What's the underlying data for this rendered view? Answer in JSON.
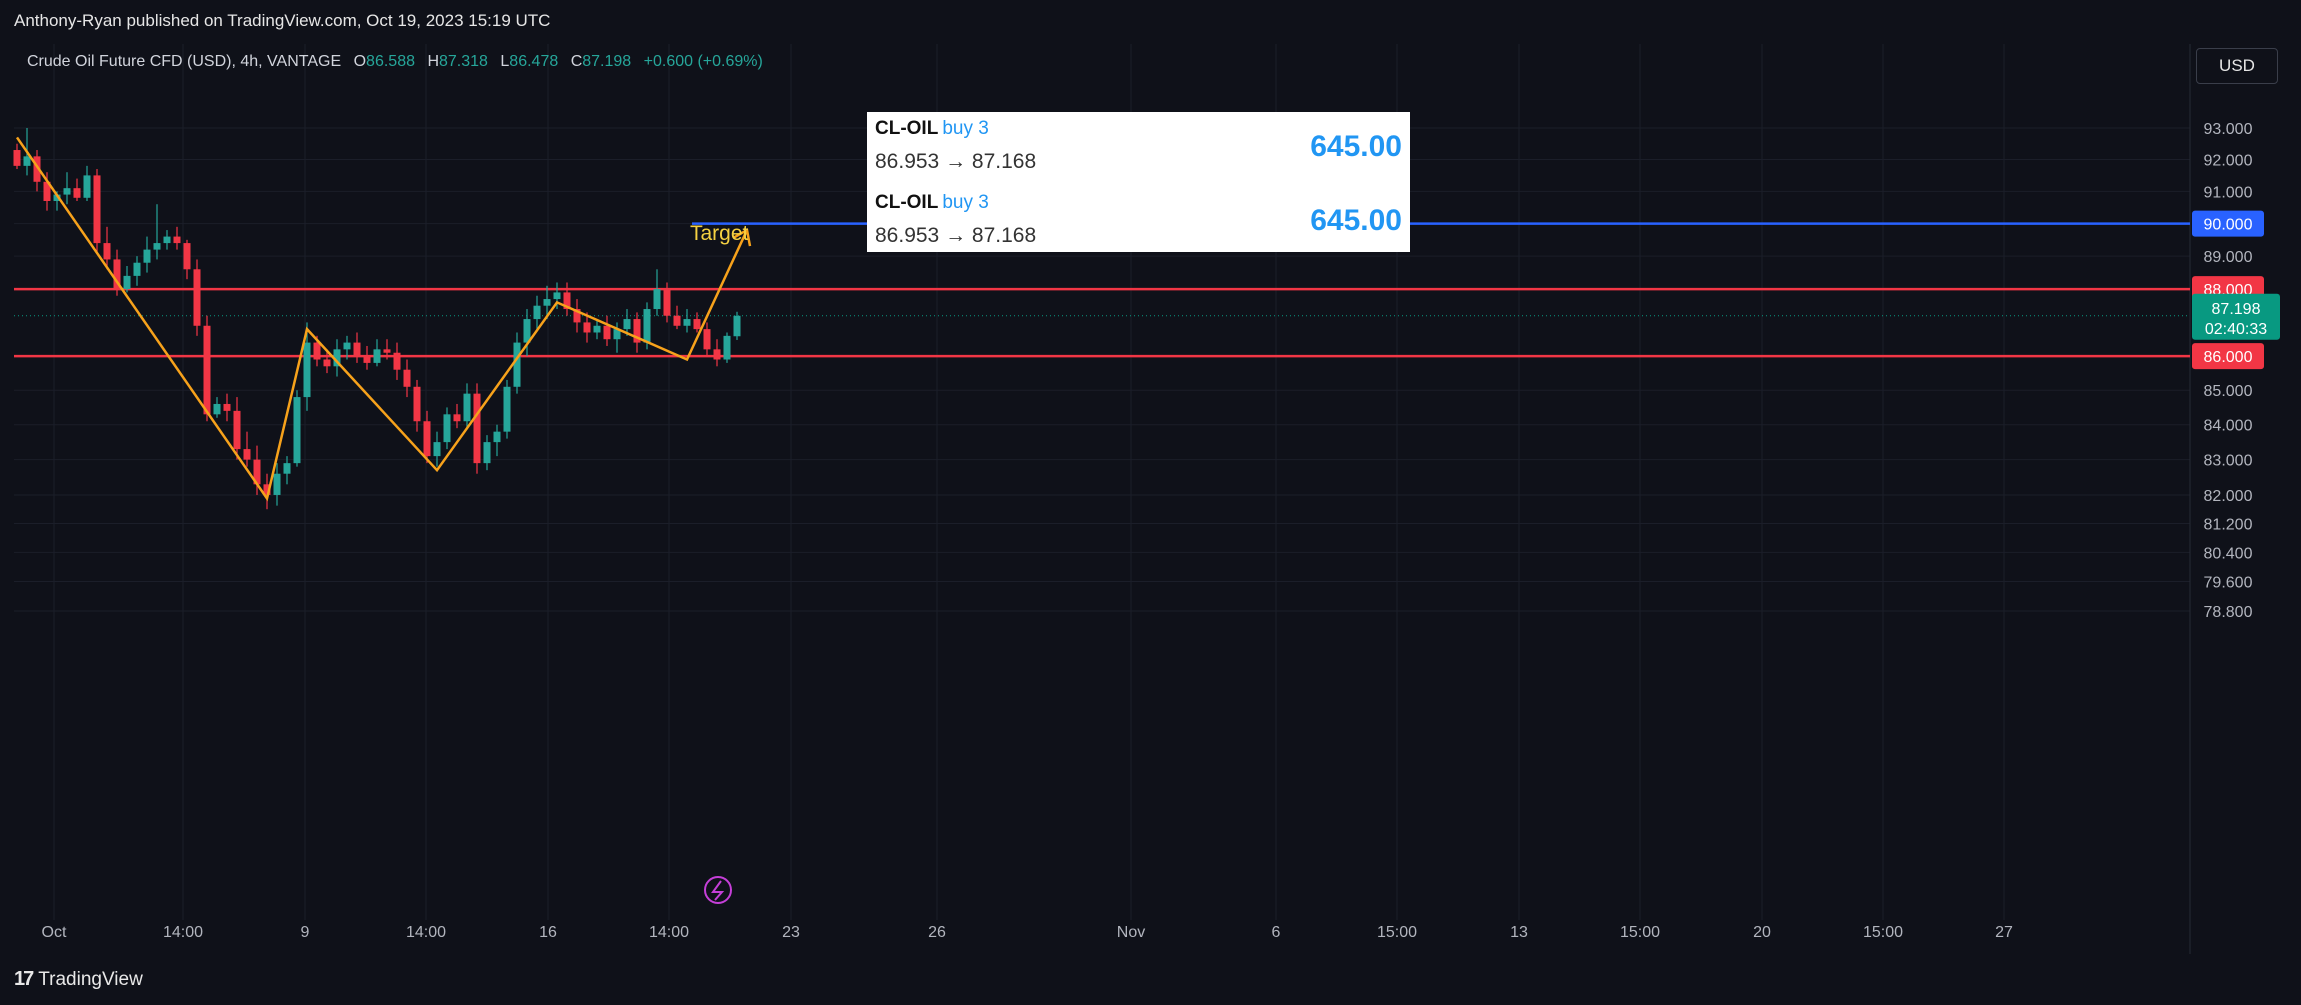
{
  "header": {
    "text": "Anthony-Ryan published on TradingView.com, Oct 19, 2023 15:19 UTC"
  },
  "legend": {
    "title": "Crude Oil Future CFD (USD), 4h, VANTAGE",
    "o_label": "O",
    "o_value": "86.588",
    "h_label": "H",
    "h_value": "87.318",
    "l_label": "L",
    "l_value": "86.478",
    "c_label": "C",
    "c_value": "87.198",
    "change": "+0.600 (+0.69%)"
  },
  "currency_button": "USD",
  "trade_box": {
    "rows": [
      {
        "symbol": "CL-OIL",
        "side": "buy 3",
        "prices": "86.953 → 87.168",
        "pnl": "645.00"
      },
      {
        "symbol": "CL-OIL",
        "side": "buy 3",
        "prices": "86.953 → 87.168",
        "pnl": "645.00"
      }
    ]
  },
  "footer": {
    "brand": "TradingView",
    "mark": "17"
  },
  "colors": {
    "background": "#0f1119",
    "up": "#26a69a",
    "down": "#f23645",
    "pattern": "#f7a21b",
    "target_line": "#2962ff",
    "support_resistance": "#f23645",
    "target_text": "#f5d142",
    "price_tag": "#089981"
  },
  "chart_data": {
    "type": "candlestick",
    "title": "Crude Oil Future CFD (USD), 4h, VANTAGE",
    "y_ticks": [
      "93.000",
      "92.000",
      "91.000",
      "90.000",
      "89.000",
      "88.000",
      "87.198",
      "86.000",
      "85.000",
      "84.000",
      "83.000",
      "82.000",
      "81.200",
      "80.400",
      "79.600",
      "78.800"
    ],
    "y_scale": "log",
    "x_ticks": [
      "Oct",
      "14:00",
      "9",
      "14:00",
      "16",
      "14:00",
      "23",
      "26",
      "Nov",
      "6",
      "15:00",
      "13",
      "15:00",
      "20",
      "15:00",
      "27"
    ],
    "horizontal_lines": [
      {
        "price": 90.0,
        "label": "90.000",
        "color": "#2962ff"
      },
      {
        "price": 88.0,
        "label": "88.000",
        "color": "#f23645"
      },
      {
        "price": 86.0,
        "label": "86.000",
        "color": "#f23645"
      }
    ],
    "last_price": {
      "value": 87.198,
      "label": "87.198",
      "countdown": "02:40:33"
    },
    "annotation": {
      "text": "Target"
    },
    "pattern_points": [
      [
        0,
        92.7
      ],
      [
        25,
        81.9
      ],
      [
        29,
        86.8
      ],
      [
        42,
        82.7
      ],
      [
        54,
        87.6
      ],
      [
        67,
        85.9
      ],
      [
        73,
        89.8
      ]
    ],
    "candles": [
      [
        92.3,
        92.5,
        91.7,
        91.8
      ],
      [
        91.8,
        93.0,
        91.5,
        92.1
      ],
      [
        92.1,
        92.3,
        91.0,
        91.3
      ],
      [
        91.3,
        91.6,
        90.4,
        90.7
      ],
      [
        90.7,
        91.0,
        90.4,
        90.9
      ],
      [
        90.9,
        91.6,
        90.6,
        91.1
      ],
      [
        91.1,
        91.4,
        90.7,
        90.8
      ],
      [
        90.8,
        91.8,
        90.7,
        91.5
      ],
      [
        91.5,
        91.7,
        89.1,
        89.4
      ],
      [
        89.4,
        89.9,
        88.6,
        88.9
      ],
      [
        88.9,
        89.2,
        87.8,
        88.0
      ],
      [
        88.0,
        88.7,
        87.9,
        88.4
      ],
      [
        88.4,
        89.0,
        88.1,
        88.8
      ],
      [
        88.8,
        89.6,
        88.5,
        89.2
      ],
      [
        89.2,
        90.6,
        88.9,
        89.4
      ],
      [
        89.4,
        89.8,
        89.2,
        89.6
      ],
      [
        89.6,
        89.9,
        89.2,
        89.4
      ],
      [
        89.4,
        89.5,
        88.3,
        88.6
      ],
      [
        88.6,
        88.9,
        86.6,
        86.9
      ],
      [
        86.9,
        87.2,
        84.1,
        84.3
      ],
      [
        84.3,
        84.8,
        84.2,
        84.6
      ],
      [
        84.6,
        84.9,
        84.1,
        84.4
      ],
      [
        84.4,
        84.8,
        83.0,
        83.3
      ],
      [
        83.3,
        83.8,
        82.8,
        83.0
      ],
      [
        83.0,
        83.4,
        82.0,
        82.3
      ],
      [
        82.3,
        82.6,
        81.6,
        82.0
      ],
      [
        82.0,
        82.9,
        81.7,
        82.6
      ],
      [
        82.6,
        83.1,
        82.3,
        82.9
      ],
      [
        82.9,
        85.0,
        82.8,
        84.8
      ],
      [
        84.8,
        87.0,
        84.4,
        86.4
      ],
      [
        86.4,
        86.6,
        85.7,
        85.9
      ],
      [
        85.9,
        86.2,
        85.5,
        85.7
      ],
      [
        85.7,
        86.5,
        85.4,
        86.2
      ],
      [
        86.2,
        86.6,
        85.9,
        86.4
      ],
      [
        86.4,
        86.7,
        85.8,
        86.0
      ],
      [
        86.0,
        86.3,
        85.6,
        85.8
      ],
      [
        85.8,
        86.5,
        85.7,
        86.2
      ],
      [
        86.2,
        86.5,
        85.9,
        86.1
      ],
      [
        86.1,
        86.4,
        85.3,
        85.6
      ],
      [
        85.6,
        85.9,
        84.8,
        85.1
      ],
      [
        85.1,
        85.3,
        83.8,
        84.1
      ],
      [
        84.1,
        84.4,
        82.9,
        83.1
      ],
      [
        83.1,
        83.8,
        82.8,
        83.5
      ],
      [
        83.5,
        84.5,
        83.3,
        84.3
      ],
      [
        84.3,
        84.6,
        83.9,
        84.1
      ],
      [
        84.1,
        85.2,
        83.9,
        84.9
      ],
      [
        84.9,
        85.2,
        82.6,
        82.9
      ],
      [
        82.9,
        83.7,
        82.7,
        83.5
      ],
      [
        83.5,
        84.0,
        83.1,
        83.8
      ],
      [
        83.8,
        85.3,
        83.6,
        85.1
      ],
      [
        85.1,
        86.7,
        84.9,
        86.4
      ],
      [
        86.4,
        87.4,
        86.0,
        87.1
      ],
      [
        87.1,
        87.8,
        86.8,
        87.5
      ],
      [
        87.5,
        88.1,
        87.1,
        87.7
      ],
      [
        87.7,
        88.2,
        87.4,
        87.9
      ],
      [
        87.9,
        88.2,
        87.2,
        87.4
      ],
      [
        87.4,
        87.7,
        86.7,
        87.0
      ],
      [
        87.0,
        87.3,
        86.4,
        86.7
      ],
      [
        86.7,
        87.1,
        86.5,
        86.9
      ],
      [
        86.9,
        87.2,
        86.3,
        86.5
      ],
      [
        86.5,
        87.0,
        86.1,
        86.8
      ],
      [
        86.8,
        87.4,
        86.6,
        87.1
      ],
      [
        87.1,
        87.3,
        86.1,
        86.4
      ],
      [
        86.4,
        87.6,
        86.2,
        87.4
      ],
      [
        87.4,
        88.6,
        87.2,
        88.0
      ],
      [
        88.0,
        88.2,
        87.0,
        87.2
      ],
      [
        87.2,
        87.5,
        86.8,
        86.9
      ],
      [
        86.9,
        87.4,
        86.7,
        87.1
      ],
      [
        87.1,
        87.3,
        86.7,
        86.8
      ],
      [
        86.8,
        87.0,
        86.0,
        86.2
      ],
      [
        86.2,
        86.5,
        85.7,
        85.9
      ],
      [
        85.9,
        86.7,
        85.8,
        86.6
      ],
      [
        86.588,
        87.318,
        86.478,
        87.198
      ]
    ]
  }
}
